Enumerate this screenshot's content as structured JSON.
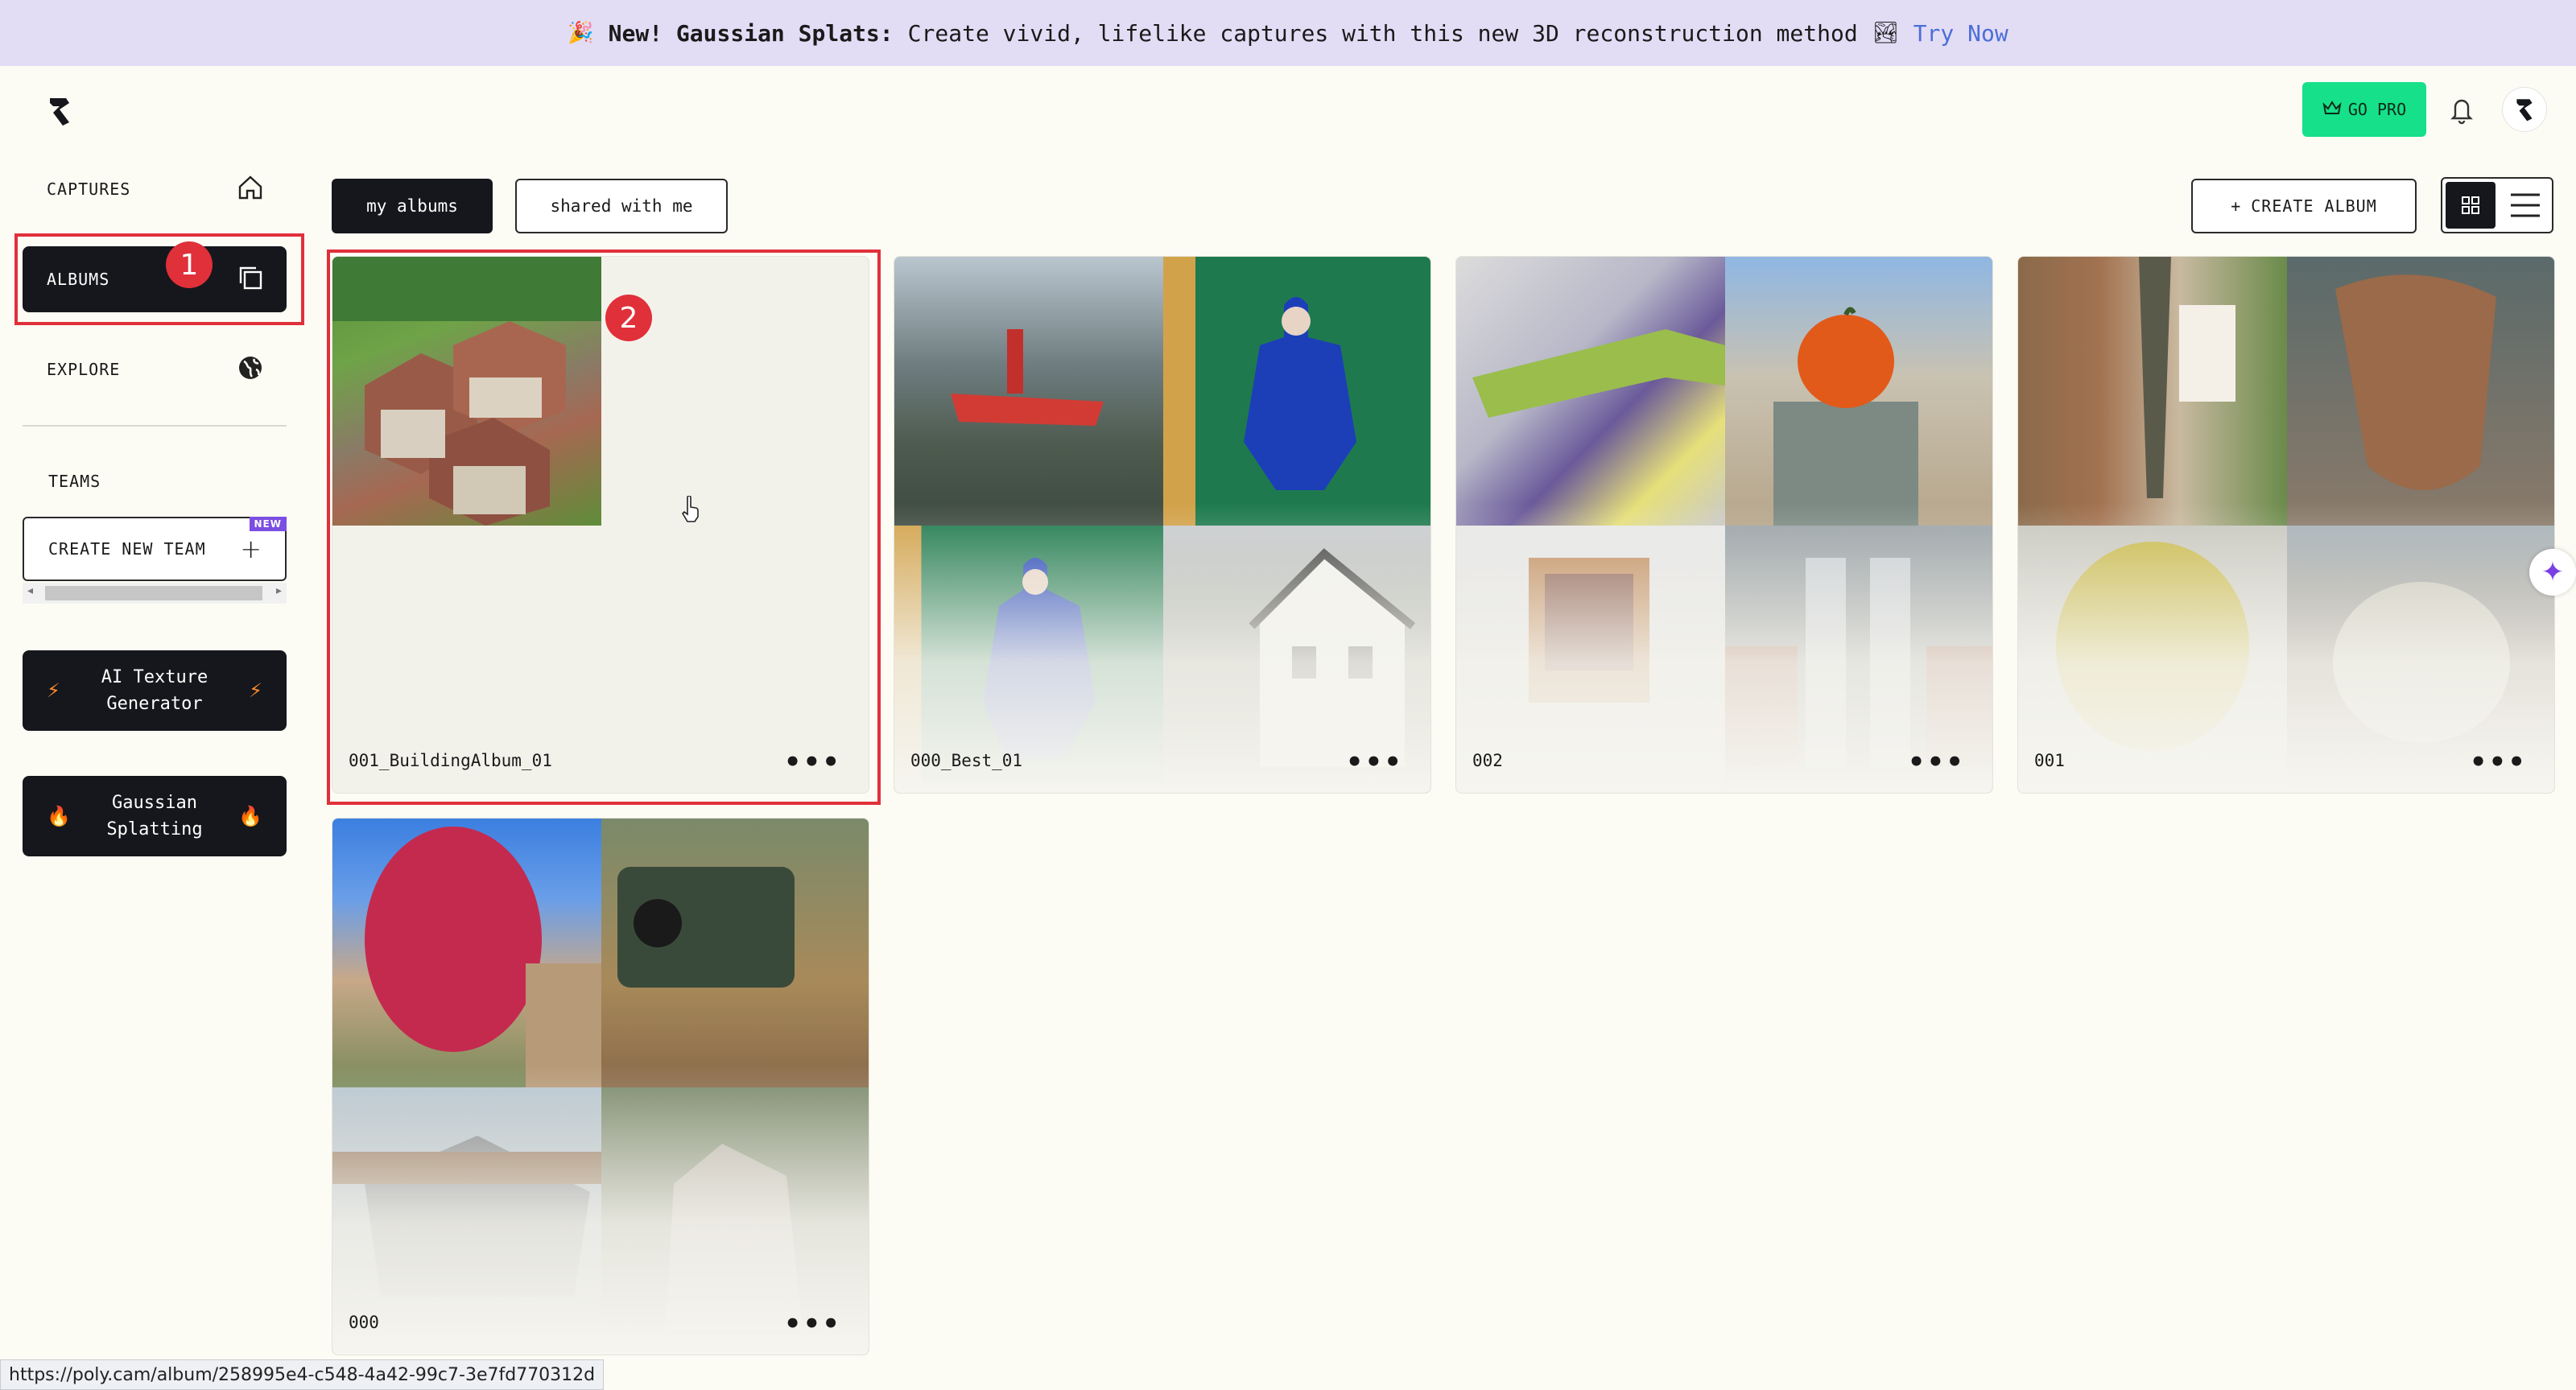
{
  "banner": {
    "emoji_left": "🎉",
    "title": "New! Gaussian Splats:",
    "text": "Create vivid, lifelike captures with this new 3D reconstruction method",
    "emoji_right": "🏞",
    "link": "Try Now"
  },
  "header": {
    "go_pro": "GO PRO",
    "accent_color": "#16e08a"
  },
  "sidebar": {
    "items": [
      {
        "label": "CAPTURES",
        "icon": "home-icon"
      },
      {
        "label": "ALBUMS",
        "icon": "copy-icon"
      },
      {
        "label": "EXPLORE",
        "icon": "globe-icon"
      }
    ],
    "teams_label": "TEAMS",
    "create_team": "CREATE NEW TEAM",
    "new_badge": "NEW",
    "ai_texture": "AI Texture Generator",
    "ai_texture_line1": "AI Texture",
    "ai_texture_line2": "Generator",
    "gaussian_line1": "Gaussian",
    "gaussian_line2": "Splatting"
  },
  "annotations": {
    "one": "1",
    "two": "2"
  },
  "toolbar": {
    "tab_mine": "my albums",
    "tab_shared": "shared with me",
    "create_album": "CREATE ALBUM",
    "create_plus": "+"
  },
  "albums": [
    {
      "name": "001_BuildingAlbum_01",
      "more": "•••"
    },
    {
      "name": "000_Best_01",
      "more": "•••"
    },
    {
      "name": "002",
      "more": "•••"
    },
    {
      "name": "001",
      "more": "•••"
    },
    {
      "name": "000",
      "more": "•••"
    }
  ],
  "status_url": "https://poly.cam/album/258995e4-c548-4a42-99c7-3e7fd770312d"
}
